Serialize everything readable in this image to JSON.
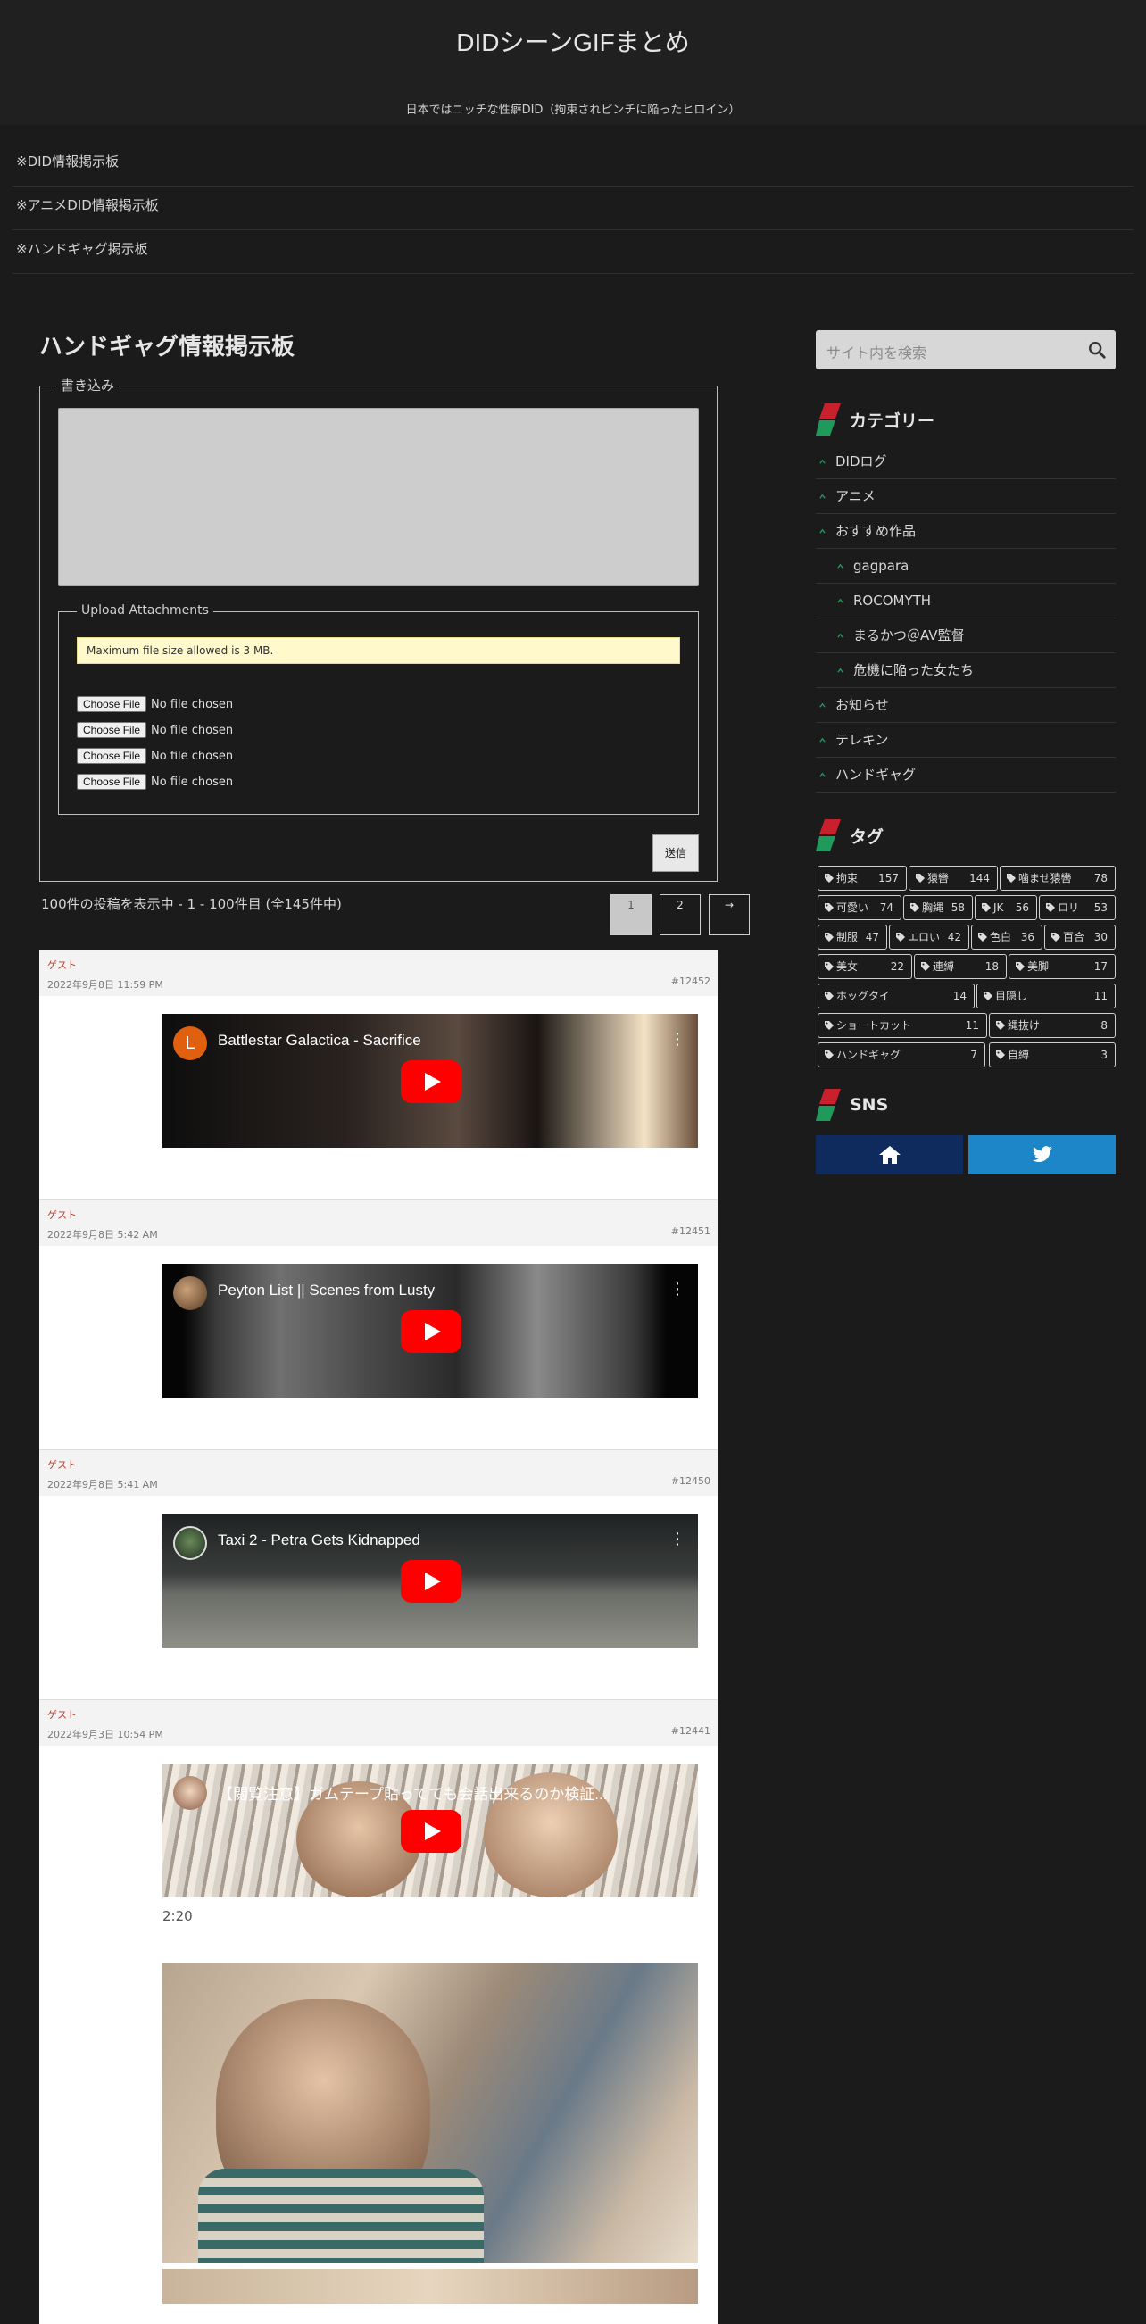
{
  "site": {
    "title": "DIDシーンGIFまとめ",
    "description": "日本ではニッチな性癖DID（拘束されピンチに陥ったヒロイン）"
  },
  "topnav": [
    "※DID情報掲示板",
    "※アニメDID情報掲示板",
    "※ハンドギャグ掲示板"
  ],
  "main": {
    "page_title": "ハンドギャグ情報掲示板",
    "form": {
      "legend": "書き込み",
      "upload_legend": "Upload Attachments",
      "notice": "Maximum file size allowed is 3 MB.",
      "file_button": "Choose File",
      "file_status": "No file chosen",
      "submit": "送信"
    },
    "count_text": "100件の投稿を表示中 - 1 - 100件目 (全145件中)",
    "pagination": [
      "1",
      "2",
      "→"
    ],
    "posts": [
      {
        "author": "ゲスト",
        "date": "2022年9月8日 11:59 PM",
        "id": "#12452",
        "video_title": "Battlestar Galactica - Sacrifice",
        "avatar_letter": "L"
      },
      {
        "author": "ゲスト",
        "date": "2022年9月8日 5:42 AM",
        "id": "#12451",
        "video_title": "Peyton List || Scenes from Lusty"
      },
      {
        "author": "ゲスト",
        "date": "2022年9月8日 5:41 AM",
        "id": "#12450",
        "video_title": "Taxi 2 - Petra Gets Kidnapped"
      },
      {
        "author": "ゲスト",
        "date": "2022年9月3日 10:54 PM",
        "id": "#12441",
        "video_title": "【閲覧注意】ガムテープ貼ってても会話出来るのか検証...",
        "duration": "2:20"
      }
    ]
  },
  "sidebar": {
    "search_placeholder": "サイト内を検索",
    "category_title": "カテゴリー",
    "categories": [
      {
        "label": "DIDログ",
        "child": false
      },
      {
        "label": "アニメ",
        "child": false
      },
      {
        "label": "おすすめ作品",
        "child": false
      },
      {
        "label": "gagpara",
        "child": true
      },
      {
        "label": "ROCOMYTH",
        "child": true
      },
      {
        "label": "まるかつ＠AV監督",
        "child": true
      },
      {
        "label": "危機に陥った女たち",
        "child": true
      },
      {
        "label": "お知らせ",
        "child": false
      },
      {
        "label": "テレキン",
        "child": false
      },
      {
        "label": "ハンドギャグ",
        "child": false
      }
    ],
    "tag_title": "タグ",
    "tags": [
      {
        "name": "拘束",
        "count": "157"
      },
      {
        "name": "猿轡",
        "count": "144"
      },
      {
        "name": "噛ませ猿轡",
        "count": "78"
      },
      {
        "name": "可愛い",
        "count": "74"
      },
      {
        "name": "胸縄",
        "count": "58"
      },
      {
        "name": "JK",
        "count": "56"
      },
      {
        "name": "ロリ",
        "count": "53"
      },
      {
        "name": "制服",
        "count": "47"
      },
      {
        "name": "エロい",
        "count": "42"
      },
      {
        "name": "色白",
        "count": "36"
      },
      {
        "name": "百合",
        "count": "30"
      },
      {
        "name": "美女",
        "count": "22"
      },
      {
        "name": "連縛",
        "count": "18"
      },
      {
        "name": "美脚",
        "count": "17"
      },
      {
        "name": "ホッグタイ",
        "count": "14"
      },
      {
        "name": "目隠し",
        "count": "11"
      },
      {
        "name": "ショートカット",
        "count": "11"
      },
      {
        "name": "縄抜け",
        "count": "8"
      },
      {
        "name": "ハンドギャグ",
        "count": "7"
      },
      {
        "name": "自縛",
        "count": "3"
      }
    ],
    "sns_title": "SNS",
    "sns": [
      {
        "icon": "home-icon",
        "color": "#0f2a5c"
      },
      {
        "icon": "twitter-icon",
        "color": "#1c86c8"
      }
    ]
  },
  "colors": {
    "background": "#1b1b1b",
    "accent_green": "#1f9a5a",
    "accent_red": "#c8202c",
    "author": "#c23b2b"
  }
}
